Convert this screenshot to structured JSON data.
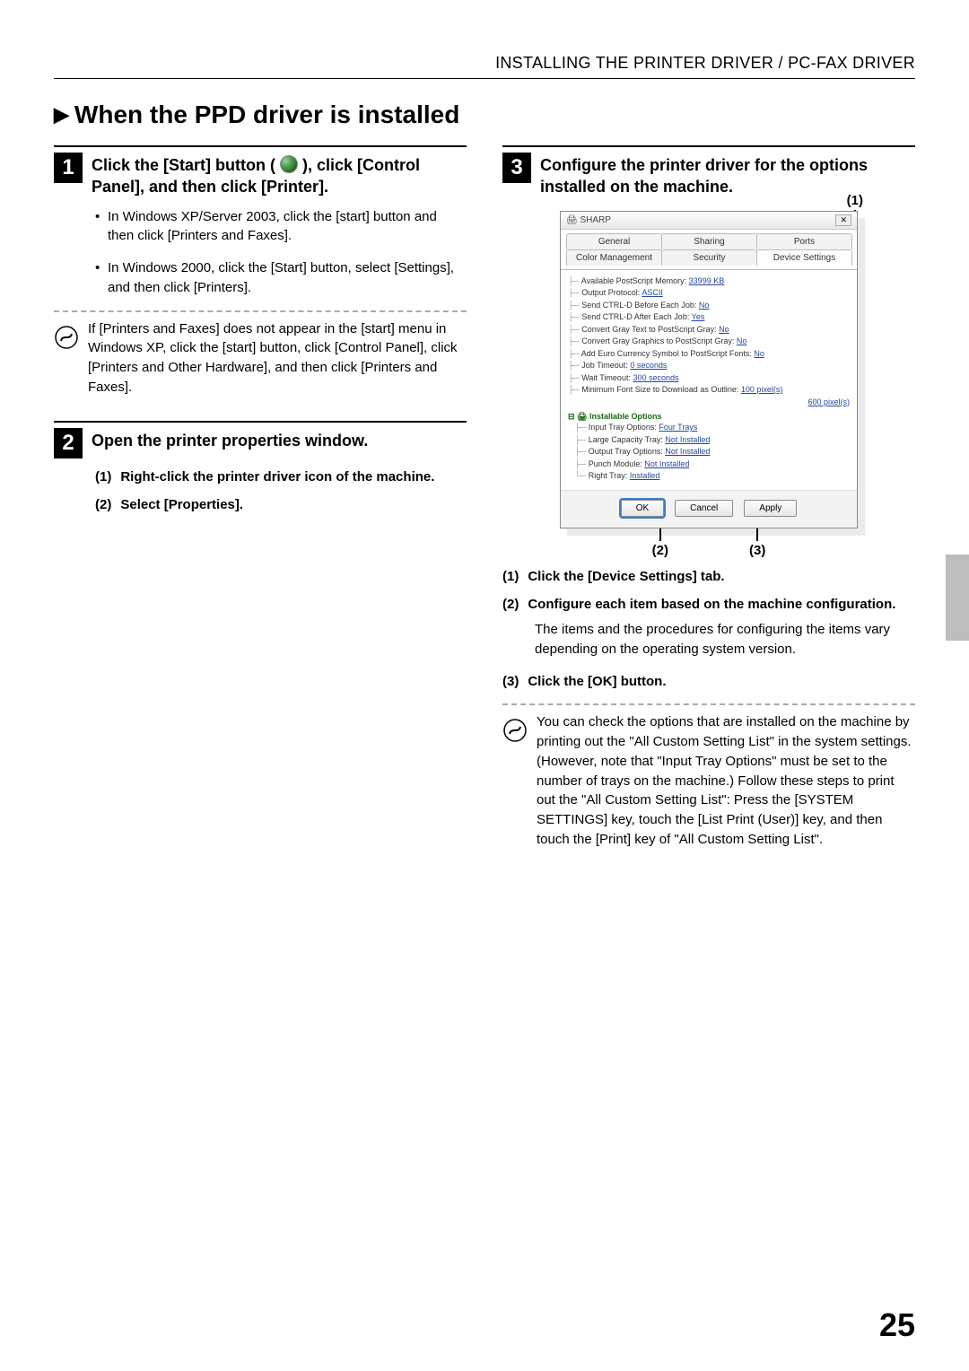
{
  "header": "INSTALLING THE PRINTER DRIVER / PC-FAX DRIVER",
  "section_title": "When the PPD driver is installed",
  "steps": {
    "s1": {
      "num": "1",
      "title_a": "Click the [Start] button ( ",
      "title_b": " ), click [Control Panel], and then click [Printer].",
      "bul1": "In Windows XP/Server 2003, click the [start] button and then click [Printers and Faxes].",
      "bul2": "In Windows 2000, click the [Start] button, select [Settings], and then click [Printers].",
      "note": "If [Printers and Faxes] does not appear in the [start] menu in Windows XP, click the [start] button, click [Control Panel], click [Printers and Other Hardware], and then click [Printers and Faxes]."
    },
    "s2": {
      "num": "2",
      "title": "Open the printer properties window.",
      "sub1_num": "(1)",
      "sub1": "Right-click the printer driver icon of the machine.",
      "sub2_num": "(2)",
      "sub2": "Select [Properties]."
    },
    "s3": {
      "num": "3",
      "title": "Configure the printer driver for the options installed on the machine.",
      "call1": "(1)",
      "call2": "(2)",
      "call3": "(3)",
      "sub1_num": "(1)",
      "sub1": "Click the [Device Settings] tab.",
      "sub2_num": "(2)",
      "sub2": "Configure each item based on the machine configuration.",
      "sub2_text": "The items and the procedures for configuring the items vary depending on the operating system version.",
      "sub3_num": "(3)",
      "sub3": "Click the [OK] button.",
      "note": "You can check the options that are installed on the machine by printing out the \"All Custom Setting List\" in the system settings. (However, note that \"Input Tray Options\" must be set to the number of trays on the machine.) Follow these steps to print out the \"All Custom Setting List\": Press the [SYSTEM SETTINGS] key, touch the [List Print (User)] key, and then touch the [Print] key of \"All Custom Setting List\"."
    }
  },
  "dialog": {
    "window_title": "SHARP",
    "tabs_row1": {
      "t1": "General",
      "t2": "Sharing",
      "t3": "Ports"
    },
    "tabs_row2": {
      "t1": "Color Management",
      "t2": "Security",
      "t3": "Device Settings"
    },
    "tree": [
      {
        "label": "Available PostScript Memory:",
        "value": "33999 KB"
      },
      {
        "label": "Output Protocol:",
        "value": "ASCII"
      },
      {
        "label": "Send CTRL-D Before Each Job:",
        "value": "No"
      },
      {
        "label": "Send CTRL-D After Each Job:",
        "value": "Yes"
      },
      {
        "label": "Convert Gray Text to PostScript Gray:",
        "value": "No"
      },
      {
        "label": "Convert Gray Graphics to PostScript Gray:",
        "value": "No"
      },
      {
        "label": "Add Euro Currency Symbol to PostScript Fonts:",
        "value": "No"
      },
      {
        "label": "Job Timeout:",
        "value": "0 seconds"
      },
      {
        "label": "Wait Timeout:",
        "value": "300 seconds"
      },
      {
        "label": "Minimum Font Size to Download as Outline:",
        "value": "100 pixel(s)"
      },
      {
        "label": "",
        "value": "600 pixel(s)"
      }
    ],
    "inst_label": "Installable Options",
    "inst": [
      {
        "label": "Input Tray Options:",
        "value": "Four Trays"
      },
      {
        "label": "Large Capacity Tray:",
        "value": "Not Installed"
      },
      {
        "label": "Output Tray Options:",
        "value": "Not Installed"
      },
      {
        "label": "Punch Module:",
        "value": "Not Installed"
      },
      {
        "label": "Right Tray:",
        "value": "Installed"
      }
    ],
    "btn_ok": "OK",
    "btn_cancel": "Cancel",
    "btn_apply": "Apply"
  },
  "page_number": "25"
}
